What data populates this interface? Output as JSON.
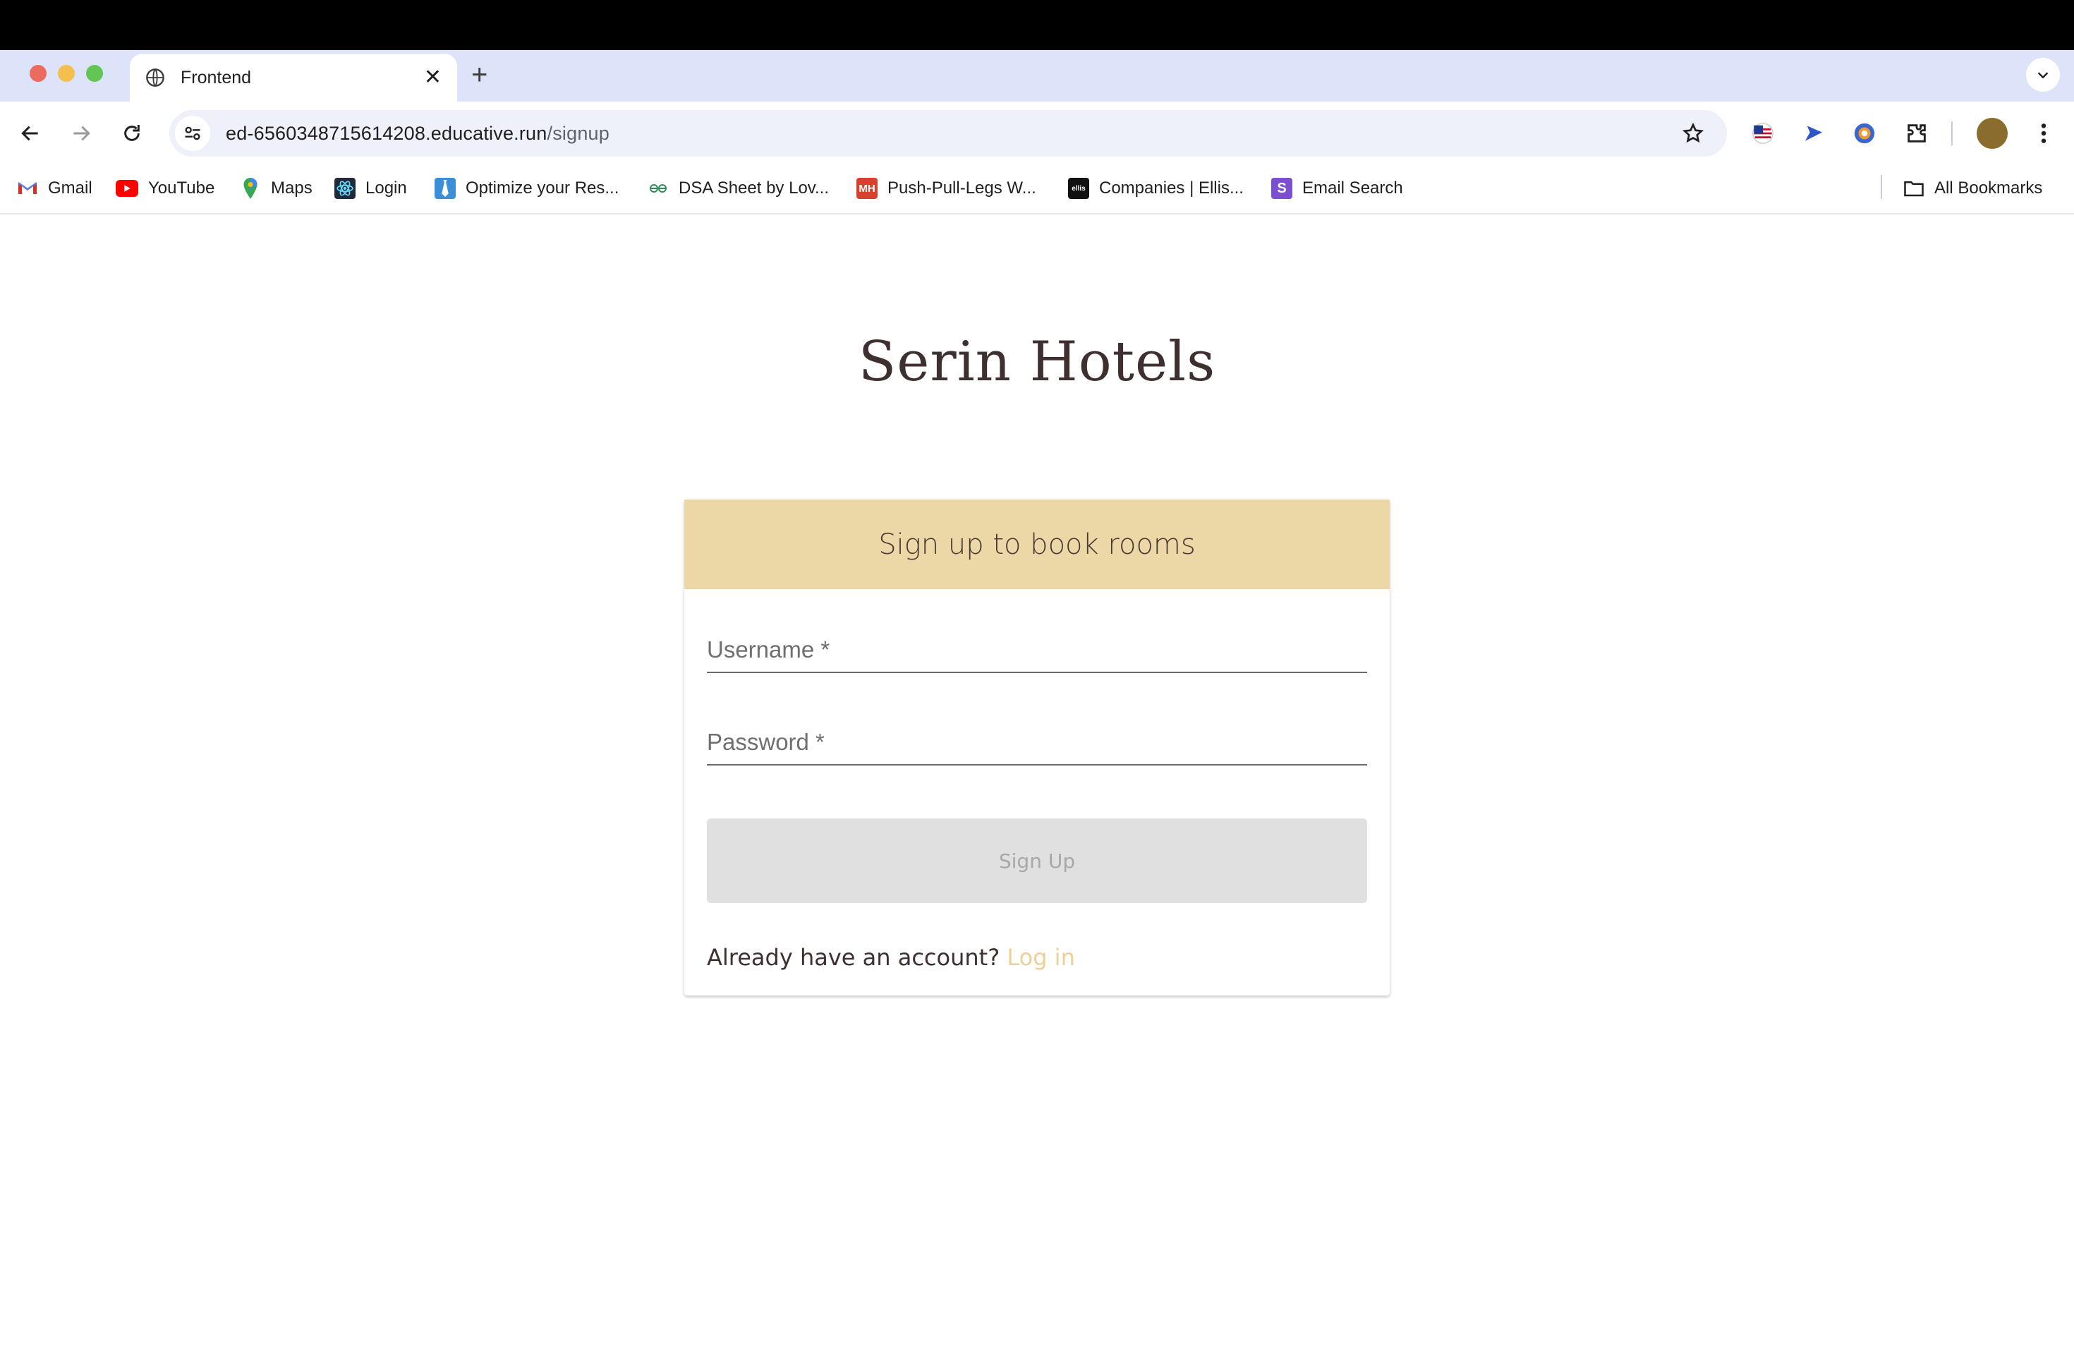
{
  "browser": {
    "tab_title": "Frontend",
    "new_tab_icon": "plus-icon",
    "url_host": "ed-6560348715614208.educative.run",
    "url_path": "/signup"
  },
  "bookmarks": [
    {
      "label": "Gmail",
      "icon": "gmail-icon"
    },
    {
      "label": "YouTube",
      "icon": "youtube-icon"
    },
    {
      "label": "Maps",
      "icon": "maps-icon"
    },
    {
      "label": "Login",
      "icon": "react-icon"
    },
    {
      "label": "Optimize your Res...",
      "icon": "tie-icon"
    },
    {
      "label": "DSA Sheet by Lov...",
      "icon": "link-icon"
    },
    {
      "label": "Push-Pull-Legs W...",
      "icon": "mh-icon"
    },
    {
      "label": "Companies | Ellis...",
      "icon": "ellis-icon"
    },
    {
      "label": "Email Search",
      "icon": "s-icon"
    }
  ],
  "all_bookmarks_label": "All Bookmarks",
  "page": {
    "site_title": "Serin Hotels",
    "card_header": "Sign up to book rooms",
    "username_label": "Username *",
    "password_label": "Password *",
    "signup_button": "Sign Up",
    "already_text": "Already have an account?",
    "login_link": "Log in"
  },
  "colors": {
    "header_bg": "#ecd8a7",
    "link": "#ecd094",
    "title": "#3e302e"
  }
}
